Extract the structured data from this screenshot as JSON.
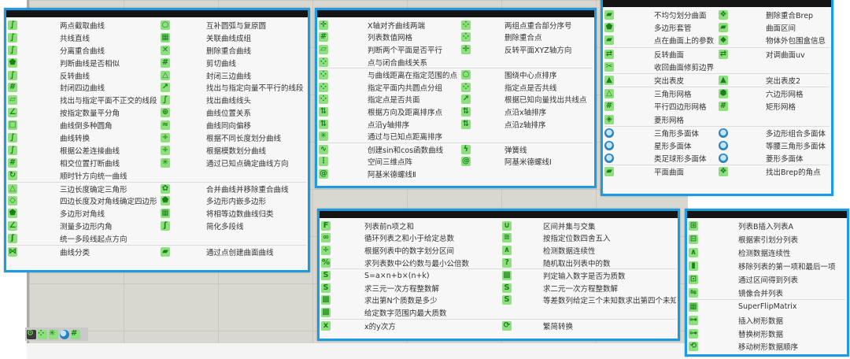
{
  "colors": {
    "accent": "#1b9be3",
    "icon_green": "#8ee07e",
    "titlebar": "#151515"
  },
  "panels": [
    {
      "sections": [
        [
          [
            "curve-icon",
            "两点截取曲线",
            "circle-icon",
            "互补圆弧与复原圆"
          ],
          [
            "curve-icon",
            "共线直线",
            "group-icon",
            "关联曲线成组"
          ],
          [
            "curve-icon",
            "分离重合曲线",
            "delete-icon",
            "删除重合曲线"
          ],
          [
            "polygon-icon",
            "判断曲线是否相似",
            "grid-icon",
            "剪切曲线"
          ],
          [
            "curve-icon",
            "反转曲线",
            "triangle-icon",
            "封闭三边曲线"
          ],
          [
            "grid-icon",
            "封闭四边曲线",
            "vector-icon",
            "找出与指定向量不平行的线段"
          ],
          [
            "plane-icon",
            "找出与指定平面不正交的线段",
            "curve-icon",
            "找出曲线线头"
          ],
          [
            "angle-icon",
            "按指定数量平分角",
            "relation-icon",
            "曲线位置关系"
          ],
          [
            "square-icon",
            "曲线倒多种圆角",
            "offset-icon",
            "曲线同向偏移"
          ],
          [
            "curve-icon",
            "曲线转换",
            "divide-icon",
            "根据不同长度划分曲线"
          ],
          [
            "curve-icon",
            "根据公差连接曲线",
            "divide-icon",
            "根据模数划分曲线"
          ],
          [
            "grid-icon",
            "相交位置打断曲线",
            "star-icon",
            "通过已知点确定曲线方向"
          ],
          [
            "rotate-icon",
            "顺时针方向统一曲线",
            "",
            ""
          ]
        ],
        [
          [
            "triangle-icon",
            "三边长度确定三角形",
            "merge-icon",
            "合并曲线并移除重合曲线"
          ],
          [
            "quad-icon",
            "四边长度及对角线确定四边形",
            "polygon-icon",
            "多边形内嵌多边形"
          ],
          [
            "polygon-icon",
            "多边形对角线",
            "group-icon",
            "将相等边数曲线归类"
          ],
          [
            "angle-icon",
            "测量多边形内角",
            "polyline-icon",
            "简化多段线"
          ],
          [
            "polyline-icon",
            "统一多段线起点方向",
            "",
            ""
          ]
        ],
        [
          [
            "classify-icon",
            "曲线分类",
            "surface-icon",
            "通过点创建曲面曲线"
          ]
        ]
      ]
    },
    {
      "sections": [
        [
          [
            "axis-icon",
            "X轴对齐曲线两端",
            "points-icon",
            "两组点重合部分序号"
          ],
          [
            "grid-icon",
            "列表数值网格",
            "points-icon",
            "删除重合点"
          ],
          [
            "plane-icon",
            "判断两个平面是否平行",
            "axis-icon",
            "反转平面XYZ轴方向"
          ],
          [
            "points-icon",
            "点与闭合曲线关系",
            "",
            ""
          ]
        ],
        [
          [
            "points-icon",
            "与曲线距离在指定范围的点",
            "circle-icon",
            "围绕中心点排序"
          ],
          [
            "points-icon",
            "指定平面内共圆点分组",
            "points-icon",
            "指定点是否共线"
          ],
          [
            "points-icon",
            "指定点是否共面",
            "vector-icon",
            "根据已知向量找出共线点"
          ],
          [
            "sort-icon",
            "根据方向及距离排序点",
            "sort-icon",
            "点沿x轴排序"
          ],
          [
            "sort-icon",
            "点沿y轴排序",
            "sort-icon",
            "点沿z轴排序"
          ],
          [
            "star-icon",
            "通过与已知点距离排序",
            "",
            ""
          ]
        ],
        [
          [
            "wave-icon",
            "创建sin和cos函数曲线",
            "spring-icon",
            "弹簧线"
          ],
          [
            "lattice-icon",
            "空间三维点阵",
            "spiral-icon",
            "阿基米德螺线Ⅰ"
          ],
          [
            "spiral-icon",
            "阿基米德螺线Ⅱ",
            "",
            ""
          ]
        ]
      ]
    },
    {
      "sections": [
        [
          [
            "surface-icon",
            "不均匀划分曲面",
            "brep-icon",
            "删除重合Brep"
          ],
          [
            "polygon-icon",
            "多边形套管",
            "surface-icon",
            "曲面区间"
          ],
          [
            "surface-icon",
            "点在曲面上的参数",
            "box-icon",
            "物体外包围盒信息"
          ]
        ],
        [
          [
            "flip-icon",
            "反转曲面",
            "flip-icon",
            "对调曲面uv"
          ],
          [
            "trim-icon",
            "收回曲面修剪边界",
            "",
            ""
          ]
        ],
        [
          [
            "extrude-icon",
            "突出表皮",
            "extrude-icon",
            "突出表皮2"
          ]
        ],
        [
          [
            "triangle-icon",
            "三角形网格",
            "hex-icon",
            "六边形网格"
          ],
          [
            "grid-icon",
            "平行四边形网格",
            "grid-icon",
            "矩形网格"
          ],
          [
            "diamond-icon",
            "菱形网格",
            "",
            ""
          ]
        ],
        [
          [
            "sphere-icon",
            "三角形多面体",
            "sphere-icon",
            "多边形组合多面体"
          ],
          [
            "sphere-icon",
            "星形多面体",
            "sphere-icon",
            "等腰三角形多面体"
          ],
          [
            "sphere-icon",
            "类足球形多面体",
            "sphere-icon",
            "菱形多面体"
          ]
        ],
        [
          [
            "surface-icon",
            "平面曲面",
            "brep-icon",
            "找出Brep的角点"
          ]
        ]
      ]
    },
    {
      "sections": [
        [
          [
            "fib-icon",
            "列表前n项之和",
            "union-icon",
            "区间并集与交集"
          ],
          [
            "loop-icon",
            "循环列表之和小于给定总数",
            "round-icon",
            "按指定位数四舍五入"
          ],
          [
            "divide-icon",
            "根据列表中的数字划分区间",
            "pulse-icon",
            "检测数据连续性"
          ],
          [
            "gcd-icon",
            "求列表数中公约数与最小公倍数",
            "random-icon",
            "随机取出列表中的数"
          ]
        ],
        [
          [
            "sum-icon",
            "S=a×n+b×(n+k)",
            "prime-icon",
            "判定输入数字是否为质数"
          ],
          [
            "sum-icon",
            "求三元一次方程整数解",
            "sum-icon",
            "求二元一次方程整数解"
          ],
          [
            "prime-icon",
            "求出第N个质数是多少",
            "sum-icon",
            "等差数列给定三个未知数求出第四个未知数"
          ],
          [
            "prime-icon",
            "给定数字范围内最大质数",
            "",
            ""
          ]
        ],
        [
          [
            "power-icon",
            "x的y次方",
            "convert-icon",
            "繁简转换"
          ]
        ]
      ]
    },
    {
      "sections": [
        [
          [
            "insert-icon",
            "列表B插入列表A"
          ],
          [
            "split-icon",
            "根据索引划分列表"
          ],
          [
            "pulse-icon",
            "检测数据连续性"
          ],
          [
            "remove-icon",
            "移除列表的第一项和最后一项"
          ],
          [
            "range-icon",
            "通过区间得到列表"
          ],
          [
            "mirror-icon",
            "镜像合并列表"
          ]
        ],
        [
          [
            "matrix-icon",
            "SuperFlipMatrix"
          ],
          [
            "tree-icon",
            "插入树形数据"
          ],
          [
            "tree-icon",
            "替换树形数据"
          ],
          [
            "refresh-icon",
            "移动树形数据顺序"
          ]
        ]
      ]
    }
  ],
  "toolbar": [
    "settings-icon",
    "points-icon",
    "star-icon",
    "sphere-icon",
    "grid-icon"
  ]
}
